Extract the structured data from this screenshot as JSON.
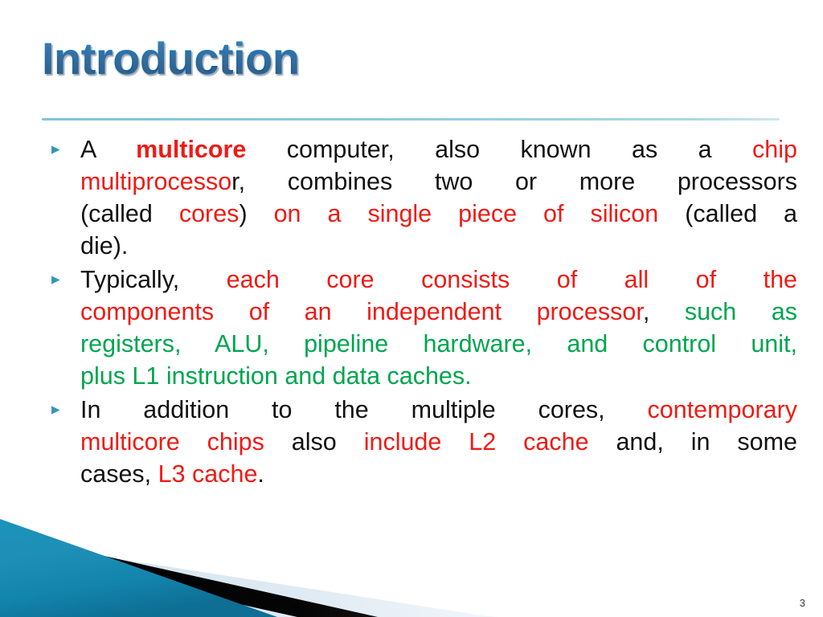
{
  "slide": {
    "title": "Introduction",
    "number": "3",
    "bullet_marker": "▸",
    "colors": {
      "title_blue": "#1670B8",
      "rule_teal": "#8ECBDC",
      "bullet_teal": "#3497B5",
      "accent_red": "#EE1B15",
      "accent_green": "#00A550",
      "body_black": "#111111",
      "deco_teal": "#1D8FB4",
      "deco_black": "#000000",
      "deco_pale": "#DCE7F0",
      "background": "#FFFFFF"
    }
  },
  "bullets": [
    {
      "id": "bullet-multicore-definition",
      "lines": [
        [
          {
            "text": "A ",
            "style": "black"
          },
          {
            "text": "multicore",
            "style": "red-bold"
          },
          {
            "text": " computer, also known as a ",
            "style": "black"
          },
          {
            "text": "chip",
            "style": "red"
          }
        ],
        [
          {
            "text": "multiprocesso",
            "style": "red"
          },
          {
            "text": "r, combines two or more processors",
            "style": "black"
          }
        ],
        [
          {
            "text": "(called ",
            "style": "black"
          },
          {
            "text": "cores",
            "style": "red"
          },
          {
            "text": ") ",
            "style": "black"
          },
          {
            "text": "on a single piece of silicon",
            "style": "red"
          },
          {
            "text": " (called a",
            "style": "black"
          }
        ],
        [
          {
            "text": "die).",
            "style": "black"
          }
        ]
      ]
    },
    {
      "id": "bullet-core-components",
      "lines": [
        [
          {
            "text": "Typically, ",
            "style": "black"
          },
          {
            "text": "each core consists of all of the",
            "style": "red"
          }
        ],
        [
          {
            "text": "components of an independent processor",
            "style": "red"
          },
          {
            "text": ", ",
            "style": "black"
          },
          {
            "text": "such as",
            "style": "green"
          }
        ],
        [
          {
            "text": "registers, ALU, pipeline hardware, and control unit,",
            "style": "green"
          }
        ],
        [
          {
            "text": "plus L1 instruction and data caches.",
            "style": "green"
          }
        ]
      ]
    },
    {
      "id": "bullet-l2-l3-cache",
      "lines": [
        [
          {
            "text": "In addition to the multiple cores, ",
            "style": "black"
          },
          {
            "text": "contemporary",
            "style": "red"
          }
        ],
        [
          {
            "text": "multicore chips",
            "style": "red"
          },
          {
            "text": " also ",
            "style": "black"
          },
          {
            "text": "include L2 cache",
            "style": "red"
          },
          {
            "text": " and, in some",
            "style": "black"
          }
        ],
        [
          {
            "text": "cases, ",
            "style": "black"
          },
          {
            "text": "L3 cache",
            "style": "red"
          },
          {
            "text": ".",
            "style": "black"
          }
        ]
      ]
    }
  ]
}
